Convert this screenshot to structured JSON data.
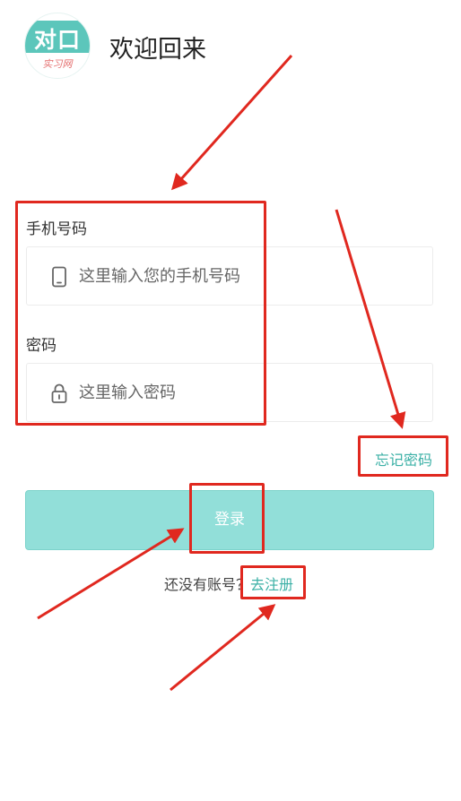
{
  "logo": {
    "big_text": "对口",
    "small_text": "实习网"
  },
  "header": {
    "title": "欢迎回来"
  },
  "form": {
    "phone": {
      "label": "手机号码",
      "placeholder": "这里输入您的手机号码",
      "value": ""
    },
    "password": {
      "label": "密码",
      "placeholder": "这里输入密码",
      "value": ""
    }
  },
  "forgot_password": "忘记密码",
  "login_button": "登录",
  "register": {
    "prompt": "还没有账号？",
    "link": "去注册"
  },
  "colors": {
    "accent": "#3bb0a6",
    "button": "#92dfd9",
    "annotation": "#e0281f"
  },
  "icons": {
    "phone": "mobile-phone-icon",
    "password": "lock-icon"
  }
}
